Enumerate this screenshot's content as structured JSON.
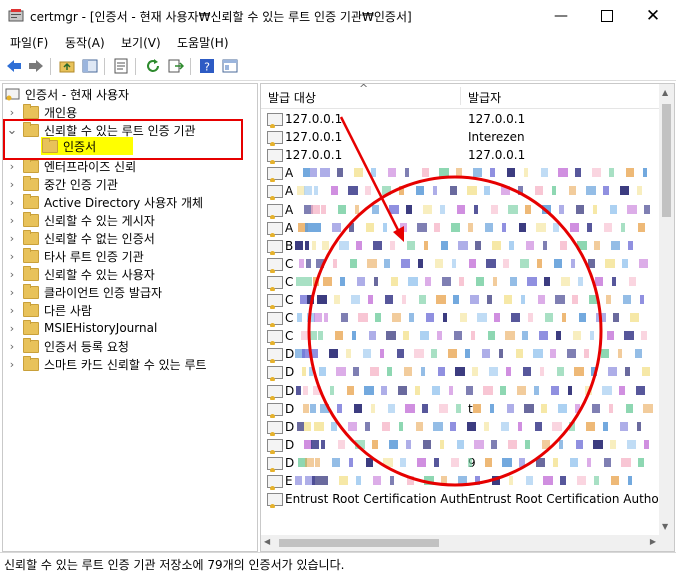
{
  "window": {
    "title": "certmgr - [인증서 - 현재 사용자₩신뢰할 수 있는 루트 인증 기관₩인증서]"
  },
  "menu": [
    "파일(F)",
    "동작(A)",
    "보기(V)",
    "도움말(H)"
  ],
  "toolbar": {
    "icons": [
      "back-arrow",
      "forward-arrow",
      "up-folder",
      "show-hide-tree",
      "properties",
      "refresh",
      "export",
      "help",
      "console-view"
    ]
  },
  "tree": {
    "root": "인증서 - 현재 사용자",
    "items": [
      {
        "label": "개인용",
        "expanded": false,
        "indent": 1
      },
      {
        "label": "신뢰할 수 있는 루트 인증 기관",
        "expanded": true,
        "indent": 1
      },
      {
        "label": "인증서",
        "expanded": false,
        "indent": 2,
        "selected": true
      },
      {
        "label": "엔터프라이즈 신뢰",
        "expanded": false,
        "indent": 1
      },
      {
        "label": "중간 인증 기관",
        "expanded": false,
        "indent": 1
      },
      {
        "label": "Active Directory 사용자 개체",
        "expanded": false,
        "indent": 1
      },
      {
        "label": "신뢰할 수 있는 게시자",
        "expanded": false,
        "indent": 1
      },
      {
        "label": "신뢰할 수 없는 인증서",
        "expanded": false,
        "indent": 1
      },
      {
        "label": "타사 루트 인증 기관",
        "expanded": false,
        "indent": 1
      },
      {
        "label": "신뢰할 수 있는 사용자",
        "expanded": false,
        "indent": 1
      },
      {
        "label": "클라이언트 인증 발급자",
        "expanded": false,
        "indent": 1
      },
      {
        "label": "다른 사람",
        "expanded": false,
        "indent": 1
      },
      {
        "label": "MSIEHistoryJournal",
        "expanded": false,
        "indent": 1
      },
      {
        "label": "인증서 등록 요청",
        "expanded": false,
        "indent": 1
      },
      {
        "label": "스마트 카드 신뢰할 수 있는 루트",
        "expanded": false,
        "indent": 1
      }
    ]
  },
  "list": {
    "columns": [
      "발급 대상",
      "발급자"
    ],
    "rows": [
      {
        "issued_to": "127.0.0.1",
        "issued_by": "127.0.0.1"
      },
      {
        "issued_to": "127.0.0.1",
        "issued_by": "Interezen"
      },
      {
        "issued_to": "127.0.0.1",
        "issued_by": "127.0.0.1"
      },
      {
        "issued_to": "A",
        "issued_by": ""
      },
      {
        "issued_to": "A",
        "issued_by": ""
      },
      {
        "issued_to": "A",
        "issued_by": ""
      },
      {
        "issued_to": "A",
        "issued_by": ""
      },
      {
        "issued_to": "B",
        "issued_by": ""
      },
      {
        "issued_to": "C",
        "issued_by": ""
      },
      {
        "issued_to": "C",
        "issued_by": ""
      },
      {
        "issued_to": "C",
        "issued_by": ""
      },
      {
        "issued_to": "C",
        "issued_by": ""
      },
      {
        "issued_to": "C",
        "issued_by": ""
      },
      {
        "issued_to": "D",
        "issued_by": ""
      },
      {
        "issued_to": "D",
        "issued_by": ""
      },
      {
        "issued_to": "D",
        "issued_by": ""
      },
      {
        "issued_to": "D",
        "issued_by": "t"
      },
      {
        "issued_to": "D",
        "issued_by": ""
      },
      {
        "issued_to": "D",
        "issued_by": ""
      },
      {
        "issued_to": "D",
        "issued_by": "9"
      },
      {
        "issued_to": "E",
        "issued_by": ""
      },
      {
        "issued_to": "Entrust Root Certification Auth...",
        "issued_by": "Entrust Root Certification Authori..."
      }
    ]
  },
  "annotations": {
    "highlight_color": "#ffff00",
    "box_color": "#e60000"
  },
  "status": "신뢰할 수 있는 루트 인증 기관 저장소에 79개의 인증서가 있습니다."
}
